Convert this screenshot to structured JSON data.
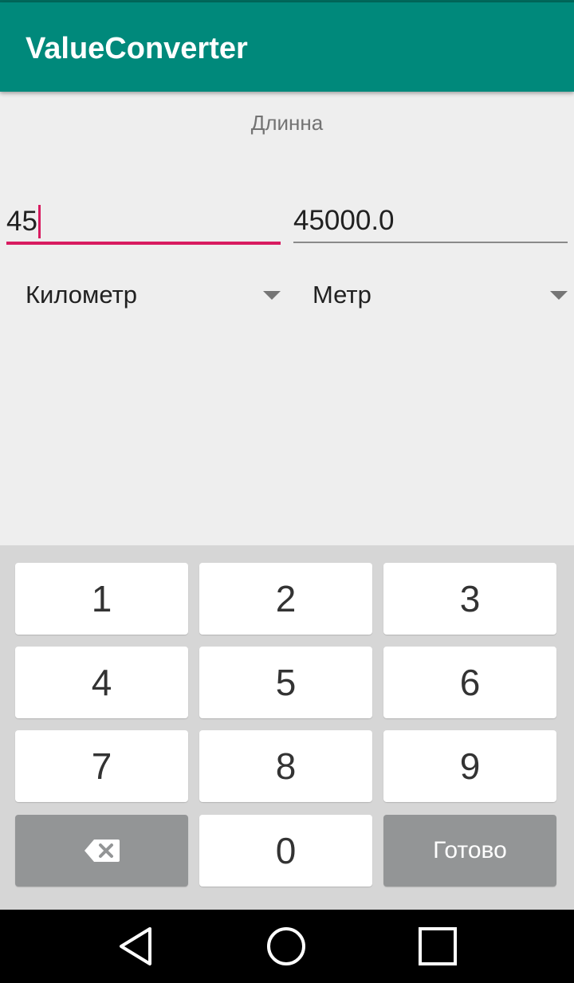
{
  "app_bar": {
    "title": "ValueConverter"
  },
  "category": {
    "label": "Длинна"
  },
  "input_field": {
    "value": "45"
  },
  "output_field": {
    "value": "45000.0"
  },
  "from_unit": {
    "selected": "Километр"
  },
  "to_unit": {
    "selected": "Метр"
  },
  "keyboard": {
    "keys": [
      "1",
      "2",
      "3",
      "4",
      "5",
      "6",
      "7",
      "8",
      "9",
      "0"
    ],
    "done_label": "Готово",
    "backspace_icon": "backspace-icon"
  },
  "nav_bar": {
    "icons": [
      "back-icon",
      "home-icon",
      "recents-icon"
    ]
  },
  "colors": {
    "app_bar": "#00897b",
    "accent": "#d81b60",
    "background": "#eeeeee",
    "keyboard_bg": "#d6d6d6",
    "action_key": "#939596"
  }
}
